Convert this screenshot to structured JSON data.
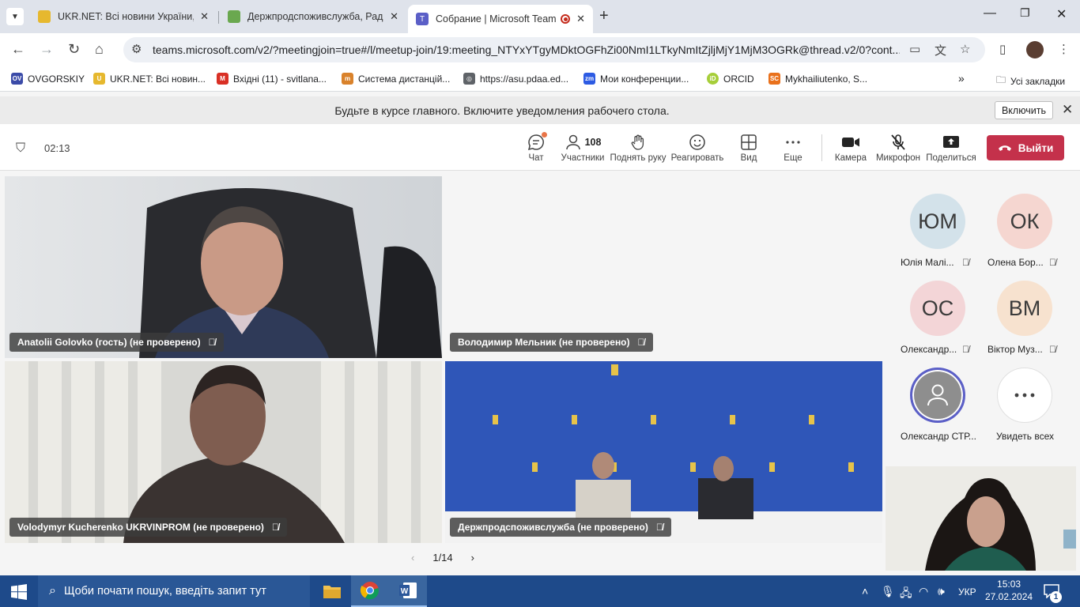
{
  "browser": {
    "tabs": [
      {
        "title": "UKR.NET: Всі новини України, ",
        "close": "✕"
      },
      {
        "title": "Держпродспоживслужба, Рад",
        "close": "✕"
      },
      {
        "title": "Собрание | Microsoft Team",
        "close": "✕"
      }
    ],
    "url": "teams.microsoft.com/v2/?meetingjoin=true#/l/meetup-join/19:meeting_NTYxYTgyMDktOGFhZi00NmI1LTkyNmItZjljMjY1MjM3OGRk@thread.v2/0?cont...",
    "bookmarks": [
      {
        "label": "OVGORSKIY",
        "color": "#3b4ba8",
        "icon": "OV"
      },
      {
        "label": "UKR.NET: Всі новин...",
        "color": "#e6b82e",
        "icon": "U"
      },
      {
        "label": "Вхідні (11) - svitlana...",
        "color": "#d93025",
        "icon": "M"
      },
      {
        "label": "Система дистанцій...",
        "color": "#d9822b",
        "icon": "m"
      },
      {
        "label": "https://asu.pdaa.ed...",
        "color": "#5f6368",
        "icon": "◎"
      },
      {
        "label": "Мои конференции...",
        "color": "#2d5be3",
        "icon": "zm"
      },
      {
        "label": "ORCID",
        "color": "#a6ce39",
        "icon": "iD"
      },
      {
        "label": "Mykhailiutenko, S...",
        "color": "#e9711c",
        "icon": "SC"
      }
    ],
    "all_bookmarks": "Усі закладки"
  },
  "notification": {
    "text": "Будьте в курсе главного. Включите уведомления рабочего стола.",
    "button": "Включить"
  },
  "meeting": {
    "timer": "02:13",
    "toolbar": [
      {
        "id": "chat",
        "label": "Чат",
        "icon": "chat-icon"
      },
      {
        "id": "people",
        "label": "Участники",
        "count": "108",
        "icon": "people-icon"
      },
      {
        "id": "raise",
        "label": "Поднять руку",
        "icon": "hand-icon"
      },
      {
        "id": "react",
        "label": "Реагировать",
        "icon": "smile-icon"
      },
      {
        "id": "view",
        "label": "Вид",
        "icon": "grid-icon"
      },
      {
        "id": "more",
        "label": "Еще",
        "icon": "more-icon"
      },
      {
        "id": "camera",
        "label": "Камера",
        "icon": "camera-icon"
      },
      {
        "id": "mic",
        "label": "Микрофон",
        "icon": "mic-off-icon"
      },
      {
        "id": "share",
        "label": "Поделиться",
        "icon": "share-icon"
      }
    ],
    "leave": "Выйти",
    "tiles": [
      {
        "name": "Anatolii Golovko (гость) (не проверено)"
      },
      {
        "name": "Володимир Мельник (не проверено)"
      },
      {
        "name": "Volodymyr Kucherenko UKRVINPROM (не проверено)"
      },
      {
        "name": "Держпродспоживслужба (не проверено)"
      }
    ],
    "avatars": [
      {
        "initials": "ЮМ",
        "name": "Юлія Малі...",
        "bg": "#d3e2ea"
      },
      {
        "initials": "ОК",
        "name": "Олена Бор...",
        "bg": "#f5d6d0"
      },
      {
        "initials": "ОС",
        "name": "Олександр...",
        "bg": "#f3d5d7"
      },
      {
        "initials": "ВМ",
        "name": "Віктор Муз...",
        "bg": "#f7e2cf"
      },
      {
        "initials": "",
        "name": "Олександр СТР..."
      },
      {
        "initials": "",
        "name": "Увидеть всех"
      }
    ],
    "pager": "1/14"
  },
  "taskbar": {
    "search_placeholder": "Щоби почати пошук, введіть запит тут",
    "lang": "УКР",
    "time": "15:03",
    "date": "27.02.2024",
    "notif_count": "1"
  }
}
